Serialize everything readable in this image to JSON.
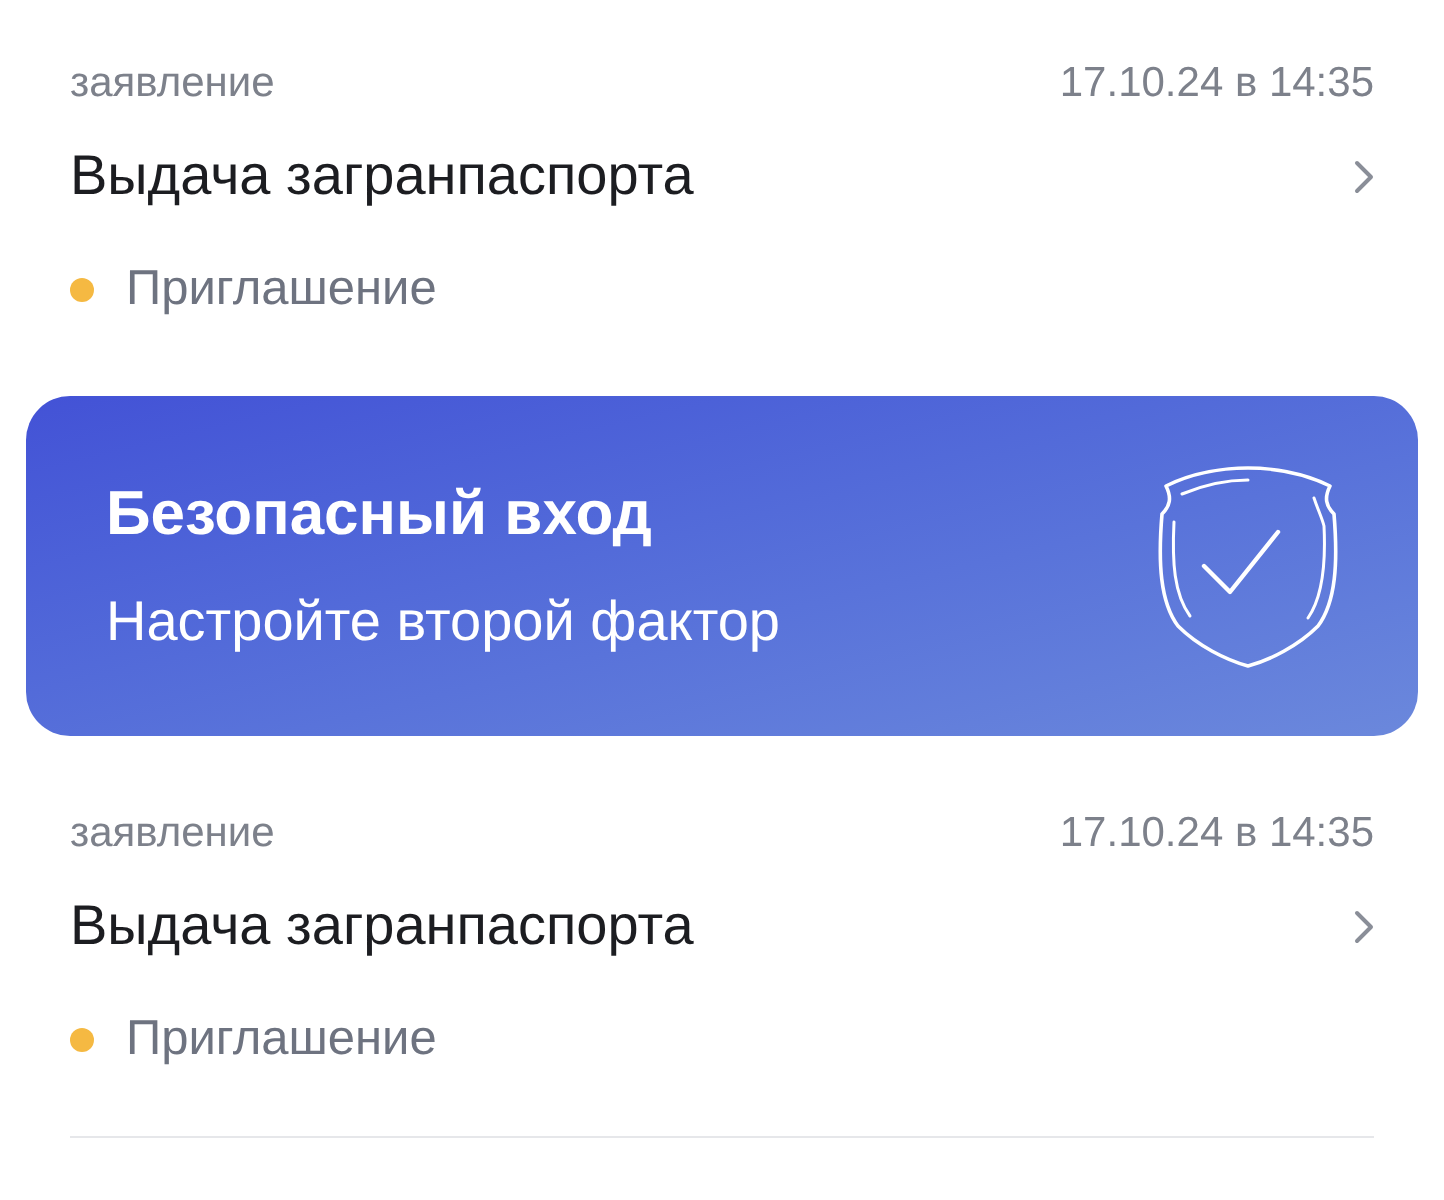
{
  "feed": [
    {
      "kind": "application",
      "type": "заявление",
      "date": "17.10.24 в 14:35",
      "title": "Выдача загранпаспорта",
      "status": {
        "label": "Приглашение",
        "color": "#f5b942"
      }
    },
    {
      "kind": "banner",
      "title": "Безопасный вход",
      "subtitle": "Настройте второй фактор"
    },
    {
      "kind": "application",
      "type": "заявление",
      "date": "17.10.24 в 14:35",
      "title": "Выдача загранпаспорта",
      "status": {
        "label": "Приглашение",
        "color": "#f5b942"
      }
    }
  ]
}
